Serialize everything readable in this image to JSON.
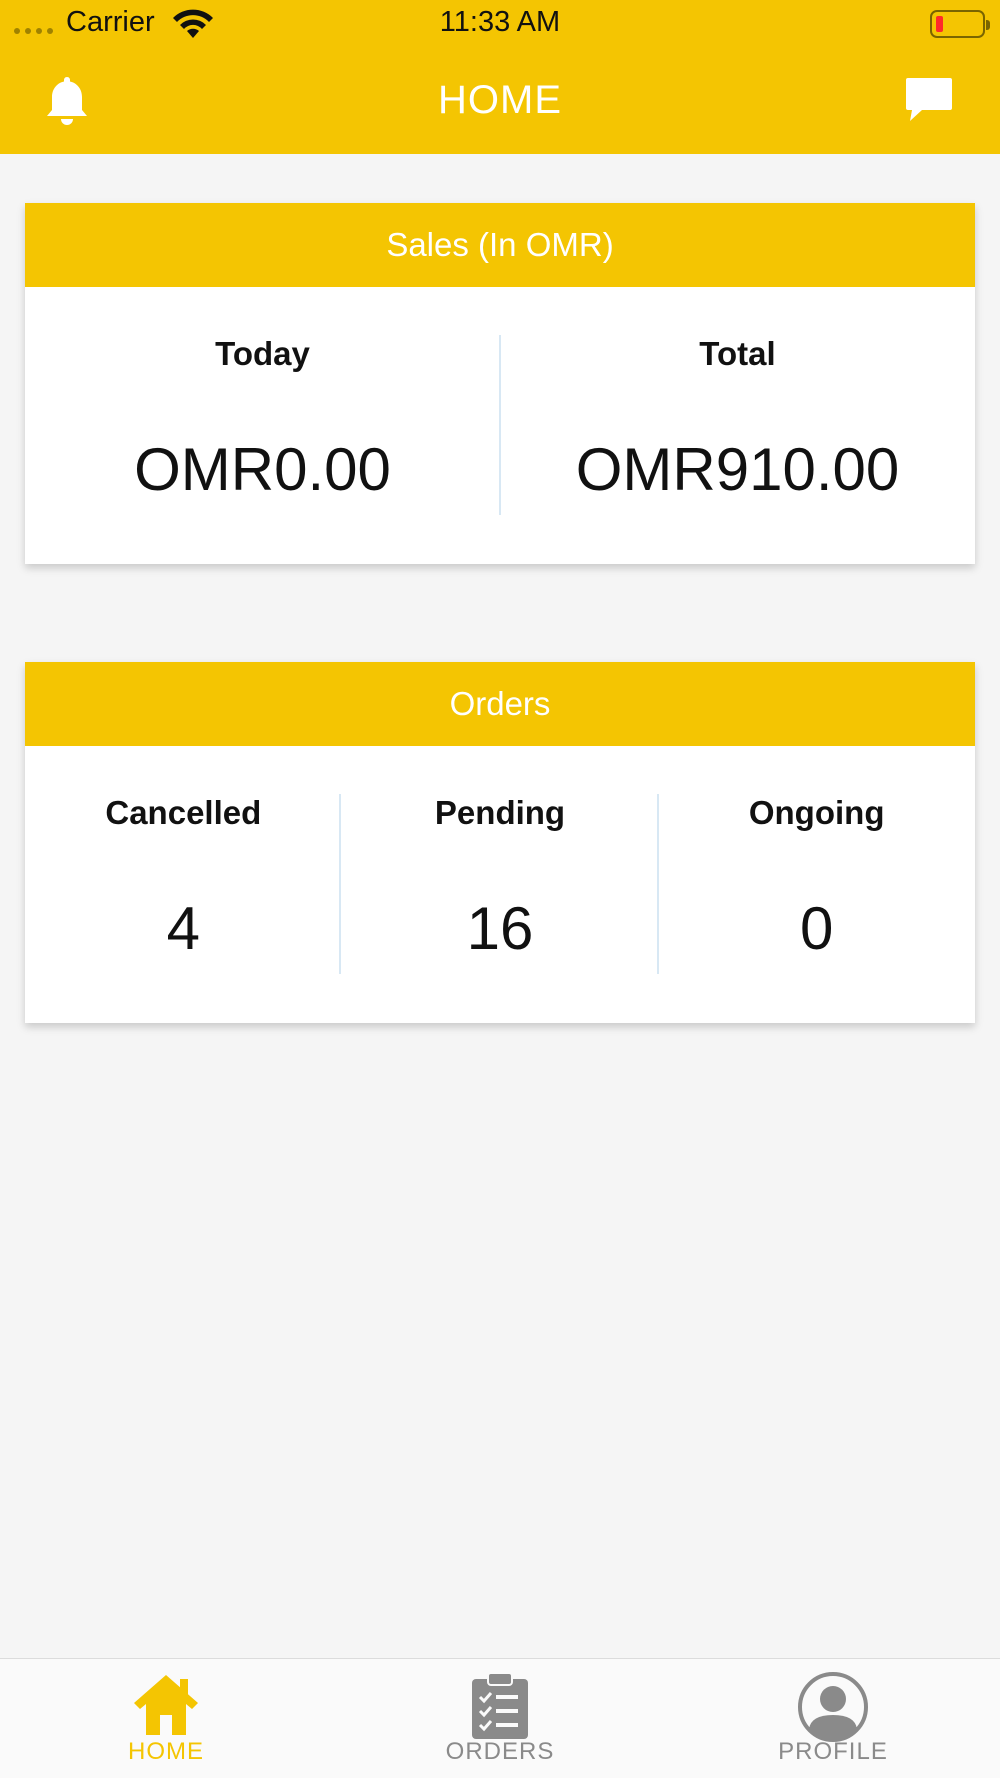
{
  "status_bar": {
    "carrier": "Carrier",
    "time": "11:33 AM"
  },
  "header": {
    "title": "HOME",
    "left_icon": "bell-icon",
    "right_icon": "chat-icon",
    "background_color": "#f4c502"
  },
  "sales": {
    "title": "Sales (In OMR)",
    "today_label": "Today",
    "today_value": "OMR0.00",
    "total_label": "Total",
    "total_value": "OMR910.00"
  },
  "orders": {
    "title": "Orders",
    "cancelled_label": "Cancelled",
    "cancelled_value": "4",
    "pending_label": "Pending",
    "pending_value": "16",
    "ongoing_label": "Ongoing",
    "ongoing_value": "0"
  },
  "tabs": [
    {
      "label": "HOME",
      "icon": "home-icon",
      "active": true
    },
    {
      "label": "ORDERS",
      "icon": "clipboard-icon",
      "active": false
    },
    {
      "label": "PROFILE",
      "icon": "user-icon",
      "active": false
    }
  ],
  "colors": {
    "accent": "#f4c502",
    "inactive": "#8a8a8a"
  }
}
